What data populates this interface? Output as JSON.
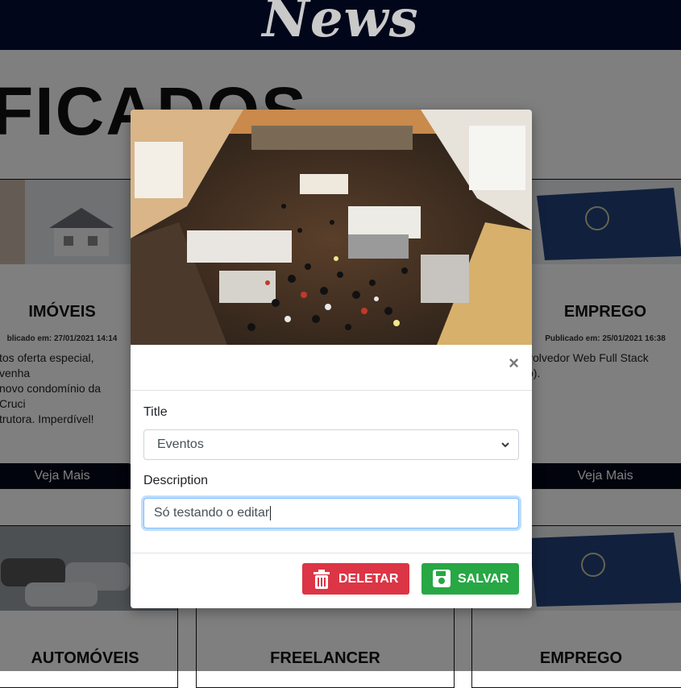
{
  "header": {
    "logo": "News"
  },
  "page": {
    "section_title": "FICADOS"
  },
  "cards": [
    {
      "title": "IMÓVEIS",
      "date": "blicado em: 27/01/2021 14:14",
      "desc_lines": [
        "tos oferta especial, venha",
        "novo condomínio da Cruci",
        "trutora. Imperdível!"
      ],
      "button": "Veja Mais"
    },
    {
      "title": "EMPREGO",
      "date": "Publicado em: 25/01/2021 16:38",
      "desc_lines": [
        "volvedor Web Full Stack",
        "o)."
      ],
      "button": "Veja Mais"
    },
    {
      "title": "AUTOMÓVEIS"
    },
    {
      "title": "FREELANCER"
    },
    {
      "title": "EMPREGO"
    }
  ],
  "modal": {
    "close": "×",
    "title_label": "Title",
    "title_value": "Eventos",
    "description_label": "Description",
    "description_value": "Só testando o editar",
    "delete_label": "DELETAR",
    "save_label": "SALVAR"
  },
  "colors": {
    "header_bg": "#02061a",
    "delete": "#dc3545",
    "save": "#28a745"
  },
  "icons": [
    "trash-icon",
    "floppy-disk-icon",
    "chevron-down-icon",
    "close-icon"
  ]
}
